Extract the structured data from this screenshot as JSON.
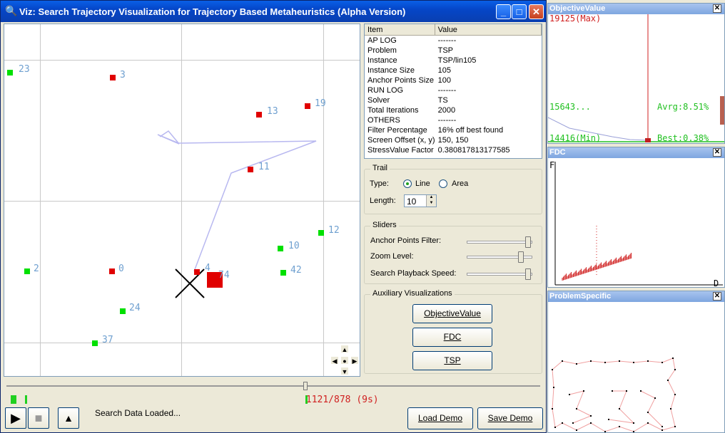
{
  "window": {
    "title": "Viz: Search Trajectory Visualization for Trajectory Based Metaheuristics (Alpha Version)",
    "minimize": "_",
    "maximize": "□",
    "close": "✕"
  },
  "canvas": {
    "anchors": [
      {
        "label": "23",
        "color": "green"
      },
      {
        "label": "3",
        "color": "red"
      },
      {
        "label": "13",
        "color": "red"
      },
      {
        "label": "19",
        "color": "red"
      },
      {
        "label": "11",
        "color": "red"
      },
      {
        "label": "12",
        "color": "green"
      },
      {
        "label": "10",
        "color": "green"
      },
      {
        "label": "2",
        "color": "green"
      },
      {
        "label": "0",
        "color": "red"
      },
      {
        "label": "4",
        "color": "red"
      },
      {
        "label": "74",
        "color": "red"
      },
      {
        "label": "42",
        "color": "green"
      },
      {
        "label": "24",
        "color": "green"
      },
      {
        "label": "37",
        "color": "green"
      }
    ],
    "nav": {
      "up": "▲",
      "down": "▼",
      "left": "◀",
      "right": "▶",
      "center": "●",
      "top": "▲"
    }
  },
  "properties": {
    "headers": [
      "Item",
      "Value"
    ],
    "rows": [
      [
        "AP LOG",
        "-------"
      ],
      [
        "Problem",
        "TSP"
      ],
      [
        "Instance",
        "TSP/lin105"
      ],
      [
        "Instance Size",
        "105"
      ],
      [
        "Anchor Points Size",
        "100"
      ],
      [
        "RUN LOG",
        "-------"
      ],
      [
        "Solver",
        "TS"
      ],
      [
        "Total Iterations",
        "2000"
      ],
      [
        "OTHERS",
        "-------"
      ],
      [
        "Filter Percentage",
        "16% off best found"
      ],
      [
        "Screen Offset (x, y)",
        "150, 150"
      ],
      [
        "StressValue Factor",
        "0.380817813177585"
      ]
    ]
  },
  "trail": {
    "legend": "Trail",
    "type_label": "Type:",
    "line_label": "Line",
    "area_label": "Area",
    "length_label": "Length:",
    "length_value": "10"
  },
  "sliders": {
    "legend": "Sliders",
    "anchor_filter_label": "Anchor Points Filter:",
    "zoom_label": "Zoom Level:",
    "playback_label": "Search Playback Speed:",
    "anchor_filter_value": 0.97,
    "zoom_value": 0.85,
    "playback_value": 0.97
  },
  "aux": {
    "legend": "Auxiliary Visualizations",
    "objective_button": "ObjectiveValue",
    "fdc_button": "FDC",
    "tsp_button": "TSP"
  },
  "timeline": {
    "progress_text": "1121/878 (9s)",
    "position": 0.56
  },
  "bottom": {
    "status": "Search Data Loaded...",
    "load_demo": "Load Demo",
    "save_demo": "Save Demo",
    "play_icon": "▶",
    "stop_icon": "■",
    "eject_icon": "▲"
  },
  "objective_panel": {
    "title": "ObjectiveValue",
    "max_label": "19125(Max)",
    "mid_label": "15643...",
    "min_label": "14416(Min)",
    "avg_label": "Avrg:8.51%",
    "best_label": "Best:0.38%"
  },
  "fdc_panel": {
    "title": "FDC",
    "y_label": "F",
    "x_label": "D"
  },
  "problem_panel": {
    "title": "ProblemSpecific"
  },
  "colors": {
    "titlebar": "#0546c8",
    "anchor_red": "#e00000",
    "anchor_green": "#00e000",
    "label_blue": "#6fa0d0",
    "objective_red": "#d02020",
    "objective_green": "#20c020"
  }
}
